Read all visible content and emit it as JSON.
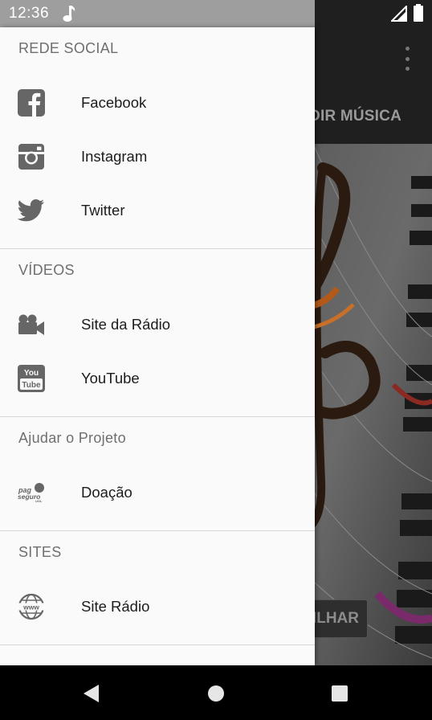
{
  "status_bar": {
    "time": "12:36",
    "icons": [
      "music-note-icon",
      "signal-icon",
      "battery-icon"
    ]
  },
  "background_app": {
    "tab_label": "DIR MÚSICA",
    "share_button_label": "TILHAR",
    "icons": [
      "more-vert-icon"
    ]
  },
  "drawer": {
    "sections": [
      {
        "header": "REDE SOCIAL",
        "items": [
          {
            "label": "Facebook",
            "icon": "facebook-icon"
          },
          {
            "label": "Instagram",
            "icon": "instagram-icon"
          },
          {
            "label": "Twitter",
            "icon": "twitter-icon"
          }
        ]
      },
      {
        "header": "VÍDEOS",
        "items": [
          {
            "label": "Site da Rádio",
            "icon": "video-camera-icon"
          },
          {
            "label": "YouTube",
            "icon": "youtube-icon"
          }
        ]
      },
      {
        "header": "Ajudar o Projeto",
        "items": [
          {
            "label": "Doação",
            "icon": "pagseguro-icon"
          }
        ]
      },
      {
        "header": "SITES",
        "items": [
          {
            "label": "Site Rádio",
            "icon": "www-globe-icon"
          }
        ]
      }
    ]
  },
  "nav_bar": {
    "buttons": [
      "back-icon",
      "home-icon",
      "recents-icon"
    ]
  },
  "colors": {
    "drawer_background": "#fafafa",
    "status_bar_drawer": "#9e9e9e",
    "icon_gray": "#666666",
    "text_primary": "#1c1c1c",
    "header_text": "#6f6f6f"
  }
}
